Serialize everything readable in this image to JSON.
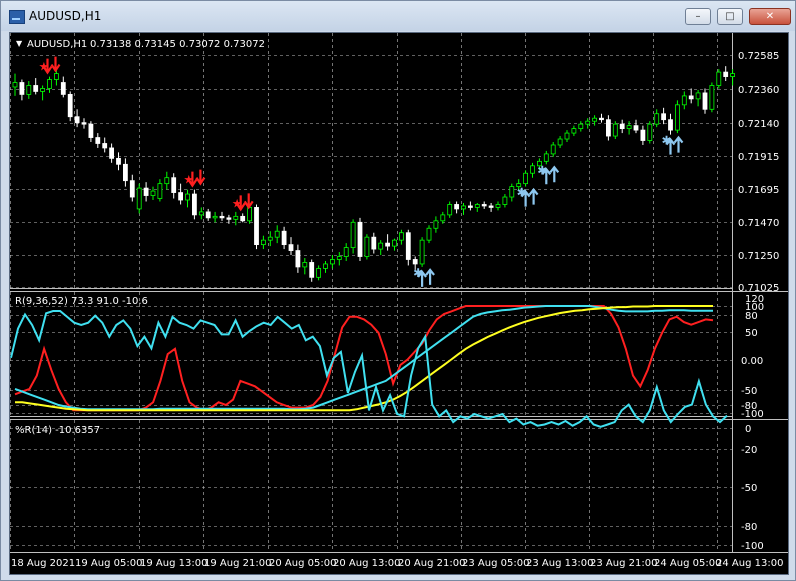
{
  "window": {
    "title": "AUDUSD,H1",
    "minimize_glyph": "–",
    "maximize_glyph": "□",
    "close_glyph": "✕"
  },
  "colors": {
    "bull": "#00ff00",
    "bear": "#ffffff",
    "grid": "#c0c0c0",
    "stoch_main": "#ff2020",
    "stoch_signal": "#40e0f0",
    "stoch_third": "#ffff20",
    "wpr": "#40e0f0",
    "sell_arrow": "#ff2020",
    "buy_arrow": "#8ec8f0"
  },
  "main": {
    "header_symbol": "AUDUSD,H1",
    "header_ohlc": "0.73138 0.73145 0.73072 0.73072",
    "price_labels": [
      "0.72585",
      "0.72360",
      "0.72140",
      "0.71915",
      "0.71695",
      "0.71470",
      "0.71250",
      "0.71025"
    ]
  },
  "osc1": {
    "label": "R(9,36,52) 73.3 91.0 -10.6",
    "axis_labels": [
      "120",
      "100",
      "80",
      "50",
      "0.00",
      "-50",
      "-80",
      "-100"
    ]
  },
  "osc2": {
    "label": "%R(14) -10.6357",
    "axis_labels": [
      "0",
      "-20",
      "-50",
      "-80",
      "-100"
    ]
  },
  "time_labels": [
    "18 Aug 2021",
    "19 Aug 05:00",
    "19 Aug 13:00",
    "19 Aug 21:00",
    "20 Aug 05:00",
    "20 Aug 13:00",
    "20 Aug 21:00",
    "23 Aug 05:00",
    "23 Aug 13:00",
    "23 Aug 21:00",
    "24 Aug 05:00",
    "24 Aug 13:00"
  ],
  "chart_data": {
    "type": "candlestick",
    "symbol": "AUDUSD",
    "timeframe": "H1",
    "ylim": [
      0.7099,
      0.7265
    ],
    "candles": [
      [
        0.7237,
        0.7246,
        0.7231,
        0.724
      ],
      [
        0.724,
        0.7242,
        0.7228,
        0.7232
      ],
      [
        0.7232,
        0.7241,
        0.7229,
        0.7238
      ],
      [
        0.7238,
        0.7243,
        0.7232,
        0.7234
      ],
      [
        0.7234,
        0.7238,
        0.7228,
        0.7236
      ],
      [
        0.7236,
        0.7244,
        0.7233,
        0.7242
      ],
      [
        0.7242,
        0.725,
        0.7238,
        0.7246
      ],
      [
        0.724,
        0.7244,
        0.723,
        0.7232
      ],
      [
        0.7232,
        0.7234,
        0.7214,
        0.7217
      ],
      [
        0.7217,
        0.7222,
        0.721,
        0.7213
      ],
      [
        0.7213,
        0.7216,
        0.7209,
        0.7212
      ],
      [
        0.7212,
        0.7214,
        0.72,
        0.7203
      ],
      [
        0.7203,
        0.7206,
        0.7196,
        0.7199
      ],
      [
        0.7199,
        0.7203,
        0.7193,
        0.7196
      ],
      [
        0.7196,
        0.7199,
        0.7186,
        0.7189
      ],
      [
        0.7189,
        0.7193,
        0.7181,
        0.7185
      ],
      [
        0.7185,
        0.7189,
        0.717,
        0.7174
      ],
      [
        0.7174,
        0.7178,
        0.716,
        0.7163
      ],
      [
        0.7155,
        0.7172,
        0.7152,
        0.7169
      ],
      [
        0.7169,
        0.7173,
        0.716,
        0.7164
      ],
      [
        0.7164,
        0.717,
        0.7161,
        0.7167
      ],
      [
        0.7162,
        0.7175,
        0.716,
        0.7172
      ],
      [
        0.7172,
        0.718,
        0.7168,
        0.7176
      ],
      [
        0.7176,
        0.7179,
        0.7162,
        0.7166
      ],
      [
        0.7166,
        0.7172,
        0.7158,
        0.7161
      ],
      [
        0.7161,
        0.7168,
        0.7156,
        0.7165
      ],
      [
        0.7165,
        0.7168,
        0.7148,
        0.7151
      ],
      [
        0.7151,
        0.7156,
        0.7148,
        0.7153
      ],
      [
        0.7153,
        0.7155,
        0.7147,
        0.7149
      ],
      [
        0.7149,
        0.7153,
        0.7146,
        0.715
      ],
      [
        0.715,
        0.7153,
        0.7147,
        0.7149
      ],
      [
        0.7149,
        0.7151,
        0.7145,
        0.7148
      ],
      [
        0.7148,
        0.7153,
        0.7144,
        0.715
      ],
      [
        0.715,
        0.7152,
        0.7146,
        0.7147
      ],
      [
        0.7147,
        0.7158,
        0.7145,
        0.7156
      ],
      [
        0.7156,
        0.7158,
        0.7128,
        0.7131
      ],
      [
        0.7131,
        0.7137,
        0.7128,
        0.7134
      ],
      [
        0.7134,
        0.714,
        0.713,
        0.7136
      ],
      [
        0.7136,
        0.7144,
        0.7132,
        0.714
      ],
      [
        0.714,
        0.7143,
        0.7128,
        0.7131
      ],
      [
        0.7131,
        0.7136,
        0.7124,
        0.7127
      ],
      [
        0.7127,
        0.7131,
        0.7112,
        0.7116
      ],
      [
        0.7116,
        0.7122,
        0.7111,
        0.7119
      ],
      [
        0.7119,
        0.7121,
        0.7106,
        0.7109
      ],
      [
        0.7109,
        0.7117,
        0.7107,
        0.7115
      ],
      [
        0.7115,
        0.712,
        0.7112,
        0.7118
      ],
      [
        0.7118,
        0.7124,
        0.7115,
        0.7121
      ],
      [
        0.7121,
        0.7126,
        0.7117,
        0.7123
      ],
      [
        0.7123,
        0.7132,
        0.712,
        0.7129
      ],
      [
        0.7129,
        0.7148,
        0.7125,
        0.7146
      ],
      [
        0.7146,
        0.7149,
        0.712,
        0.7123
      ],
      [
        0.7123,
        0.7138,
        0.7121,
        0.7136
      ],
      [
        0.7136,
        0.7139,
        0.7125,
        0.7128
      ],
      [
        0.7128,
        0.7134,
        0.7124,
        0.7132
      ],
      [
        0.7132,
        0.7138,
        0.7127,
        0.713
      ],
      [
        0.713,
        0.7135,
        0.7127,
        0.7134
      ],
      [
        0.7134,
        0.7141,
        0.7131,
        0.7139
      ],
      [
        0.7139,
        0.7141,
        0.7117,
        0.7121
      ],
      [
        0.7121,
        0.7123,
        0.7114,
        0.7118
      ],
      [
        0.7118,
        0.7136,
        0.7116,
        0.7134
      ],
      [
        0.7134,
        0.7144,
        0.7132,
        0.7142
      ],
      [
        0.7142,
        0.715,
        0.7139,
        0.7147
      ],
      [
        0.7147,
        0.7153,
        0.7145,
        0.7151
      ],
      [
        0.7151,
        0.716,
        0.7149,
        0.7158
      ],
      [
        0.7158,
        0.716,
        0.7152,
        0.7155
      ],
      [
        0.7155,
        0.7159,
        0.7151,
        0.7157
      ],
      [
        0.7157,
        0.716,
        0.7154,
        0.7156
      ],
      [
        0.7156,
        0.7159,
        0.7153,
        0.7158
      ],
      [
        0.7158,
        0.716,
        0.7155,
        0.7157
      ],
      [
        0.7157,
        0.7159,
        0.7153,
        0.7156
      ],
      [
        0.7156,
        0.716,
        0.7154,
        0.7158
      ],
      [
        0.7158,
        0.7165,
        0.7156,
        0.7163
      ],
      [
        0.7163,
        0.7172,
        0.716,
        0.717
      ],
      [
        0.717,
        0.7175,
        0.7167,
        0.7172
      ],
      [
        0.7172,
        0.7181,
        0.717,
        0.7179
      ],
      [
        0.7179,
        0.7186,
        0.7176,
        0.7184
      ],
      [
        0.7184,
        0.7189,
        0.7181,
        0.7187
      ],
      [
        0.7187,
        0.7194,
        0.7185,
        0.7192
      ],
      [
        0.7192,
        0.72,
        0.719,
        0.7198
      ],
      [
        0.7198,
        0.7204,
        0.7196,
        0.7202
      ],
      [
        0.7202,
        0.7208,
        0.72,
        0.7206
      ],
      [
        0.7206,
        0.7211,
        0.7204,
        0.7209
      ],
      [
        0.7209,
        0.7214,
        0.7207,
        0.7212
      ],
      [
        0.7212,
        0.7216,
        0.7209,
        0.7214
      ],
      [
        0.7214,
        0.7218,
        0.7211,
        0.7216
      ],
      [
        0.7216,
        0.7219,
        0.7213,
        0.7215
      ],
      [
        0.7215,
        0.7218,
        0.7201,
        0.7204
      ],
      [
        0.7204,
        0.7214,
        0.7202,
        0.7212
      ],
      [
        0.7212,
        0.7215,
        0.7206,
        0.7209
      ],
      [
        0.7209,
        0.7214,
        0.7205,
        0.7211
      ],
      [
        0.7211,
        0.7215,
        0.7206,
        0.7208
      ],
      [
        0.7208,
        0.7211,
        0.7198,
        0.7201
      ],
      [
        0.7201,
        0.7214,
        0.7199,
        0.7212
      ],
      [
        0.7212,
        0.7222,
        0.721,
        0.7219
      ],
      [
        0.7219,
        0.7223,
        0.7212,
        0.7215
      ],
      [
        0.7215,
        0.7219,
        0.7205,
        0.7208
      ],
      [
        0.7208,
        0.7228,
        0.7206,
        0.7225
      ],
      [
        0.7225,
        0.7234,
        0.7222,
        0.7231
      ],
      [
        0.7231,
        0.7236,
        0.7226,
        0.7229
      ],
      [
        0.7229,
        0.7235,
        0.7224,
        0.7233
      ],
      [
        0.7233,
        0.7236,
        0.7219,
        0.7222
      ],
      [
        0.7222,
        0.724,
        0.722,
        0.7238
      ],
      [
        0.7238,
        0.7249,
        0.7236,
        0.7247
      ],
      [
        0.7247,
        0.7251,
        0.7241,
        0.7244
      ],
      [
        0.7244,
        0.7249,
        0.7238,
        0.7246
      ]
    ],
    "sell_signals": [
      5,
      26,
      33
    ],
    "buy_signals": [
      59,
      74,
      77,
      95
    ],
    "oscillator_1": {
      "ylim": [
        -110,
        120
      ],
      "series": [
        {
          "values": [
            -65,
            -60,
            -55,
            -30,
            20,
            -20,
            -55,
            -80,
            -95,
            -95,
            -95,
            -95,
            -95,
            -95,
            -95,
            -95,
            -95,
            -95,
            -90,
            -80,
            -40,
            10,
            20,
            -40,
            -80,
            -90,
            -95,
            -90,
            -80,
            -85,
            -75,
            -40,
            -45,
            -50,
            -60,
            -70,
            -80,
            -85,
            -90,
            -90,
            -90,
            -85,
            -70,
            -40,
            10,
            60,
            80,
            80,
            75,
            65,
            50,
            10,
            -45,
            -10,
            0,
            15,
            30,
            55,
            75,
            85,
            90,
            95,
            100,
            100,
            100,
            100,
            100,
            100,
            100,
            100,
            100,
            100,
            100,
            100,
            100,
            100,
            100,
            100,
            100,
            100,
            100,
            100,
            85,
            60,
            20,
            -30,
            -50,
            -20,
            20,
            50,
            75,
            80,
            70,
            65,
            70,
            75,
            73.3
          ]
        },
        {
          "values": [
            -55,
            -60,
            -65,
            -70,
            -75,
            -80,
            -85,
            -88,
            -90,
            -92,
            -93,
            -93,
            -93,
            -93,
            -93,
            -93,
            -93,
            -93,
            -93,
            -93,
            -92,
            -92,
            -92,
            -92,
            -92,
            -92,
            -92,
            -92,
            -92,
            -92,
            -92,
            -92,
            -92,
            -92,
            -92,
            -92,
            -92,
            -92,
            -93,
            -93,
            -92,
            -90,
            -85,
            -80,
            -75,
            -70,
            -65,
            -60,
            -55,
            -50,
            -45,
            -40,
            -30,
            -20,
            -10,
            0,
            10,
            20,
            30,
            40,
            50,
            60,
            70,
            80,
            85,
            88,
            90,
            92,
            93,
            95,
            97,
            98,
            99,
            100,
            100,
            100,
            100,
            100,
            100,
            100,
            98,
            96,
            93,
            91,
            90,
            90,
            90,
            90,
            91,
            91,
            92,
            92,
            92,
            91,
            91,
            91,
            91.0
          ]
        },
        {
          "values": [
            -80,
            -80,
            -82,
            -84,
            -86,
            -88,
            -90,
            -92,
            -93,
            -94,
            -95,
            -95,
            -95,
            -95,
            -95,
            -95,
            -95,
            -95,
            -95,
            -95,
            -95,
            -95,
            -95,
            -95,
            -95,
            -95,
            -95,
            -95,
            -95,
            -95,
            -95,
            -95,
            -95,
            -95,
            -95,
            -95,
            -95,
            -95,
            -95,
            -95,
            -95,
            -95,
            -95,
            -95,
            -95,
            -95,
            -95,
            -93,
            -90,
            -87,
            -84,
            -80,
            -75,
            -68,
            -60,
            -50,
            -40,
            -30,
            -20,
            -10,
            0,
            10,
            20,
            28,
            35,
            42,
            48,
            54,
            60,
            65,
            70,
            74,
            78,
            81,
            84,
            87,
            89,
            91,
            92,
            94,
            95,
            96,
            97,
            98,
            98,
            99,
            99,
            99,
            100,
            100,
            100,
            100,
            100,
            100,
            100,
            100,
            100
          ]
        }
      ]
    },
    "oscillator_2": {
      "name": "%R(14)",
      "ylim": [
        -105,
        3
      ],
      "values": [
        -60,
        -85,
        -97,
        -88,
        -75,
        -98,
        -100,
        -100,
        -95,
        -90,
        -88,
        -90,
        -96,
        -90,
        -78,
        -88,
        -92,
        -85,
        -70,
        -78,
        -68,
        -90,
        -78,
        -95,
        -90,
        -88,
        -85,
        -92,
        -90,
        -88,
        -80,
        -80,
        -92,
        -78,
        -83,
        -87,
        -90,
        -88,
        -95,
        -90,
        -85,
        -88,
        -75,
        -78,
        -70,
        -45,
        -60,
        -65,
        -30,
        -48,
        -62,
        -15,
        -35,
        -15,
        -28,
        -12,
        -10,
        -45,
        -68,
        -78,
        -20,
        -10,
        -15,
        -5,
        -10,
        -8,
        -12,
        -10,
        -8,
        -10,
        -12,
        -5,
        -8,
        -3,
        -5,
        -2,
        -3,
        -5,
        -3,
        -6,
        -2,
        -5,
        -10,
        -3,
        -1,
        -3,
        -5,
        -15,
        -20,
        -10,
        -5,
        -15,
        -35,
        -15,
        -5,
        -12,
        -18,
        -20,
        -40,
        -20,
        -10,
        -5,
        -10.6357
      ]
    }
  }
}
